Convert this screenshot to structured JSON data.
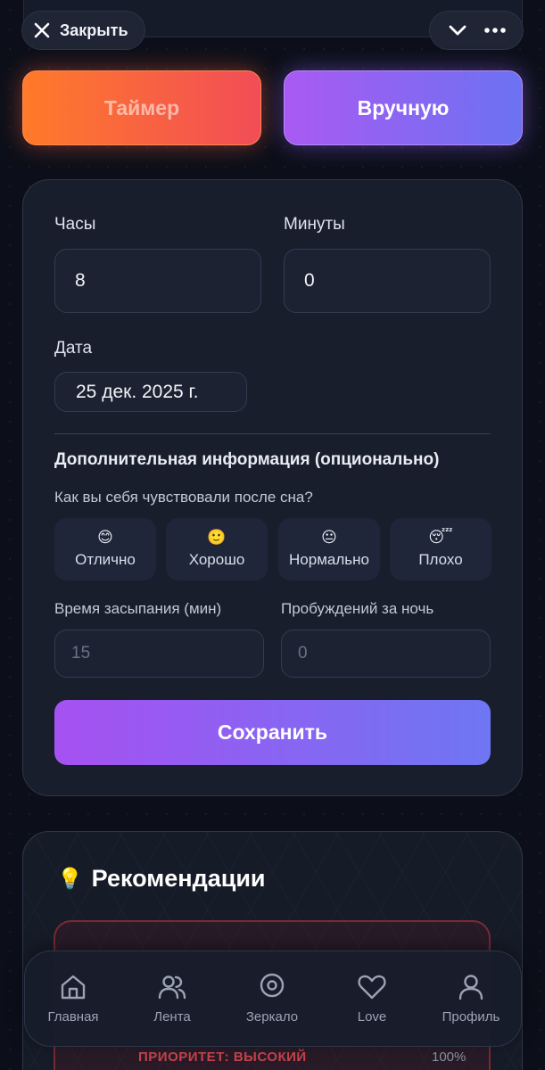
{
  "topbar": {
    "close_label": "Закрыть",
    "close_icon": "close-icon",
    "collapse_icon": "chevron-down-icon",
    "more_icon": "more-horizontal-icon"
  },
  "modes": {
    "timer_label": "Таймер",
    "manual_label": "Вручную",
    "active": "manual"
  },
  "form": {
    "hours_label": "Часы",
    "hours_value": "8",
    "minutes_label": "Минуты",
    "minutes_value": "0",
    "date_label": "Дата",
    "date_value": "25 дек. 2025 г.",
    "extra_title": "Дополнительная информация (опционально)",
    "feeling_question": "Как вы себя чувствовали после сна?",
    "moods": [
      {
        "emoji": "😊",
        "label": "Отлично"
      },
      {
        "emoji": "🙂",
        "label": "Хорошо"
      },
      {
        "emoji": "😐",
        "label": "Нормально"
      },
      {
        "emoji": "😴",
        "label": "Плохо"
      }
    ],
    "fall_asleep_label": "Время засыпания (мин)",
    "fall_asleep_placeholder": "15",
    "awakenings_label": "Пробуждений за ночь",
    "awakenings_placeholder": "0",
    "save_label": "Сохранить"
  },
  "recommendations": {
    "icon": "💡",
    "title": "Рекомендации",
    "priority_label": "ПРИОРИТЕТ: ВЫСОКИЙ",
    "percent": "100%"
  },
  "bottom_nav": {
    "items": [
      {
        "label": "Главная",
        "icon": "home-icon"
      },
      {
        "label": "Лента",
        "icon": "users-icon"
      },
      {
        "label": "Зеркало",
        "icon": "location-pin-icon"
      },
      {
        "label": "Love",
        "icon": "heart-icon"
      },
      {
        "label": "Профиль",
        "icon": "user-icon"
      }
    ]
  },
  "colors": {
    "background": "#0c0f19",
    "card": "#1b202f",
    "accent_purple": "#a651f1",
    "accent_blue": "#6e76f3",
    "accent_orange": "#ff7a2a",
    "accent_red": "#f24d57",
    "priority_red": "#c9434e"
  }
}
